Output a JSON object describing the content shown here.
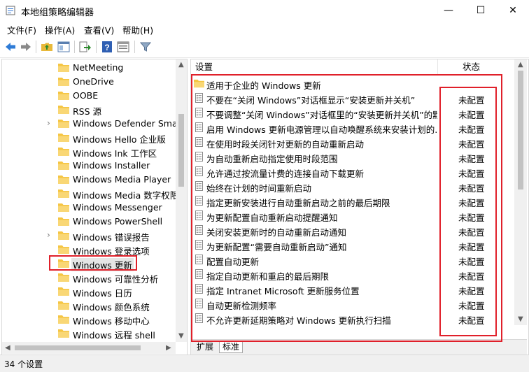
{
  "window": {
    "title": "本地组策略编辑器",
    "icon": "policy-editor-icon",
    "controls": [
      "minimize-icon",
      "maximize-icon",
      "close-icon"
    ]
  },
  "menu": [
    "文件(F)",
    "操作(A)",
    "查看(V)",
    "帮助(H)"
  ],
  "toolbar": {
    "icons": [
      "back-arrow-icon",
      "forward-arrow-icon",
      "up-folder-icon",
      "show-hide-tree-icon",
      "export-list-icon",
      "help-icon",
      "properties-icon",
      "filter-icon"
    ]
  },
  "tree": {
    "items": [
      {
        "label": "NetMeeting",
        "expandable": false
      },
      {
        "label": "OneDrive",
        "expandable": false
      },
      {
        "label": "OOBE",
        "expandable": false
      },
      {
        "label": "RSS 源",
        "expandable": false
      },
      {
        "label": "Windows Defender Smar",
        "expandable": true
      },
      {
        "label": "Windows Hello 企业版",
        "expandable": false
      },
      {
        "label": "Windows Ink 工作区",
        "expandable": false
      },
      {
        "label": "Windows Installer",
        "expandable": false
      },
      {
        "label": "Windows Media Player",
        "expandable": false
      },
      {
        "label": "Windows Media 数字权限",
        "expandable": false
      },
      {
        "label": "Windows Messenger",
        "expandable": false
      },
      {
        "label": "Windows PowerShell",
        "expandable": false
      },
      {
        "label": "Windows 错误报告",
        "expandable": true
      },
      {
        "label": "Windows 登录选项",
        "expandable": false
      },
      {
        "label": "Windows 更新",
        "expandable": false,
        "selected": true
      },
      {
        "label": "Windows 可靠性分析",
        "expandable": false
      },
      {
        "label": "Windows 日历",
        "expandable": false
      },
      {
        "label": "Windows 颜色系统",
        "expandable": false
      },
      {
        "label": "Windows 移动中心",
        "expandable": false
      },
      {
        "label": "Windows 远程 shell",
        "expandable": false
      }
    ]
  },
  "list": {
    "columns": {
      "setting": "设置",
      "state": "状态"
    },
    "rows": [
      {
        "type": "folder",
        "text": "适用于企业的 Windows 更新",
        "state": ""
      },
      {
        "type": "policy",
        "text": "不要在“关闭 Windows”对话框显示“安装更新并关机”",
        "state": "未配置"
      },
      {
        "type": "policy",
        "text": "不要调整“关闭 Windows”对话框里的“安装更新并关机”的默...",
        "state": "未配置"
      },
      {
        "type": "policy",
        "text": "启用 Windows 更新电源管理以自动唤醒系统来安装计划的...",
        "state": "未配置"
      },
      {
        "type": "policy",
        "text": "在使用时段关闭针对更新的自动重新启动",
        "state": "未配置"
      },
      {
        "type": "policy",
        "text": "为自动重新启动指定使用时段范围",
        "state": "未配置"
      },
      {
        "type": "policy",
        "text": "允许通过按流量计费的连接自动下载更新",
        "state": "未配置"
      },
      {
        "type": "policy",
        "text": "始终在计划的时间重新启动",
        "state": "未配置"
      },
      {
        "type": "policy",
        "text": "指定更新安装进行自动重新启动之前的最后期限",
        "state": "未配置"
      },
      {
        "type": "policy",
        "text": "为更新配置自动重新启动提醒通知",
        "state": "未配置"
      },
      {
        "type": "policy",
        "text": "关闭安装更新时的自动重新启动通知",
        "state": "未配置"
      },
      {
        "type": "policy",
        "text": "为更新配置“需要自动重新启动”通知",
        "state": "未配置"
      },
      {
        "type": "policy",
        "text": "配置自动更新",
        "state": "未配置"
      },
      {
        "type": "policy",
        "text": "指定自动更新和重启的最后期限",
        "state": "未配置"
      },
      {
        "type": "policy",
        "text": "指定 Intranet Microsoft 更新服务位置",
        "state": "未配置"
      },
      {
        "type": "policy",
        "text": "自动更新检测频率",
        "state": "未配置"
      },
      {
        "type": "policy",
        "text": "不允许更新延期策略对 Windows 更新执行扫描",
        "state": "未配置"
      }
    ]
  },
  "tabs": [
    "扩展",
    "标准"
  ],
  "active_tab": "标准",
  "status": "34 个设置",
  "colors": {
    "annotation": "#e0202a",
    "folder": "#f5c542"
  }
}
